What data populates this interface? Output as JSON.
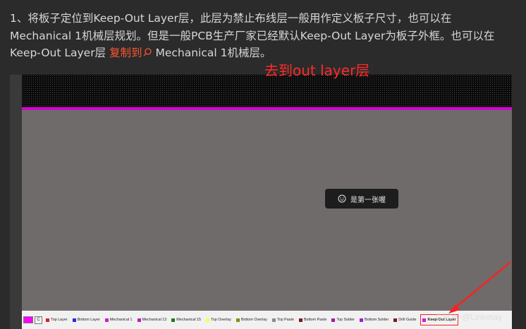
{
  "article": {
    "line1": "1、将板子定位到Keep-Out Layer层，此层为禁止布线层一般用作定义板子尺寸，也可以在",
    "line2": "Mechanical 1机械层规划。但是一般PCB生产厂家已经默认Keep-Out Layer为板子外框。也可以在",
    "line3_pre": "Keep-Out Layer层 ",
    "link_text": "复制到",
    "line3_post": " Mechanical 1机械层。"
  },
  "figure": {
    "annotation": "去到out layer层",
    "toast": "是第一张喔",
    "current_layer_label": "C",
    "layer_tabs": [
      {
        "label": "Top Layer",
        "color": "#e11b1b"
      },
      {
        "label": "Bottom Layer",
        "color": "#1b2de1"
      },
      {
        "label": "Mechanical 1",
        "color": "#d21bd2"
      },
      {
        "label": "Mechanical 13",
        "color": "#c31bc3"
      },
      {
        "label": "Mechanical 15",
        "color": "#1b7a1b"
      },
      {
        "label": "Top Overlay",
        "color": "#ffff3a"
      },
      {
        "label": "Bottom Overlay",
        "color": "#8a8a1b"
      },
      {
        "label": "Top Paste",
        "color": "#8a8a8a"
      },
      {
        "label": "Bottom Paste",
        "color": "#7a1b1b"
      },
      {
        "label": "Top Solder",
        "color": "#a31ba3"
      },
      {
        "label": "Bottom Solder",
        "color": "#a31bd2"
      },
      {
        "label": "Drill Guide",
        "color": "#7a1b1b"
      },
      {
        "label": "Keep-Out Layer",
        "color": "#d21bd2",
        "active": true
      }
    ],
    "watermark": "CSDN @Linketay"
  }
}
